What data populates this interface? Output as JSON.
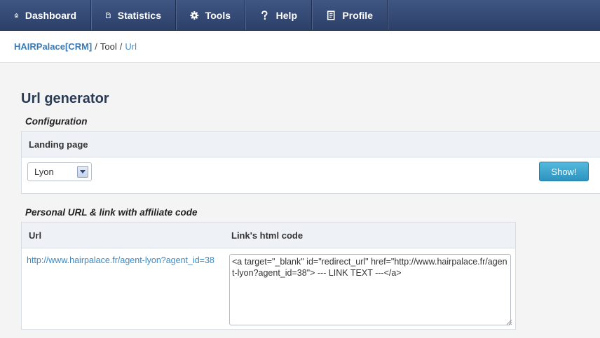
{
  "nav": {
    "items": [
      {
        "label": "Dashboard",
        "icon": "home-icon"
      },
      {
        "label": "Statistics",
        "icon": "document-icon"
      },
      {
        "label": "Tools",
        "icon": "gear-icon"
      },
      {
        "label": "Help",
        "icon": "question-icon"
      },
      {
        "label": "Profile",
        "icon": "profile-card-icon"
      }
    ]
  },
  "breadcrumb": {
    "root": "HAIRPalace[CRM]",
    "sep1": "/",
    "middle": "Tool",
    "sep2": "/",
    "current": "Url"
  },
  "page": {
    "title": "Url generator"
  },
  "configuration": {
    "title": "Configuration",
    "header": "Landing page",
    "select_value": "Lyon",
    "show_button": "Show!"
  },
  "personal": {
    "title": "Personal URL & link with affiliate code",
    "col_url": "Url",
    "col_html": "Link's html code",
    "url": "http://www.hairpalace.fr/agent-lyon?agent_id=38",
    "html_code": "<a target=\"_blank\" id=\"redirect_url\" href=\"http://www.hairpalace.fr/agent-lyon?agent_id=38\"> --- LINK TEXT ---</a>"
  },
  "colors": {
    "nav_bg": "#34486f",
    "link": "#3a8ac4",
    "button": "#3ba3cf",
    "title": "#2a3b55"
  }
}
